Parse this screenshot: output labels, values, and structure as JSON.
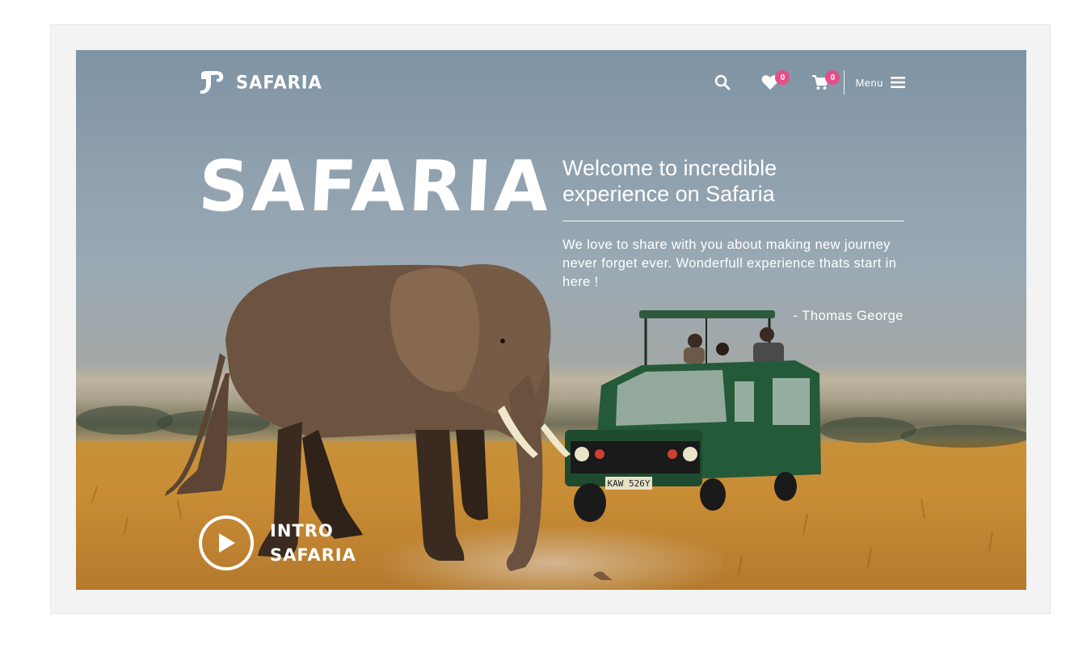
{
  "brand": {
    "logo_text": "SAFARIA",
    "accent": "#e64e88"
  },
  "header": {
    "search_icon": "search-icon",
    "wishlist": {
      "icon": "heart-icon",
      "count": "0"
    },
    "cart": {
      "icon": "cart-icon",
      "count": "0"
    },
    "menu_label": "Menu",
    "menu_icon": "hamburger-icon"
  },
  "hero": {
    "title": "SAFARIA",
    "welcome_heading": "Welcome to incredible experience on Safaria",
    "body": "We love to share with you about making new journey never forget ever. Wonderfull experience thats start in here !",
    "author": "- Thomas George",
    "intro_label": "INTRO SAFARIA",
    "license_plate": "KAW 526Y"
  }
}
